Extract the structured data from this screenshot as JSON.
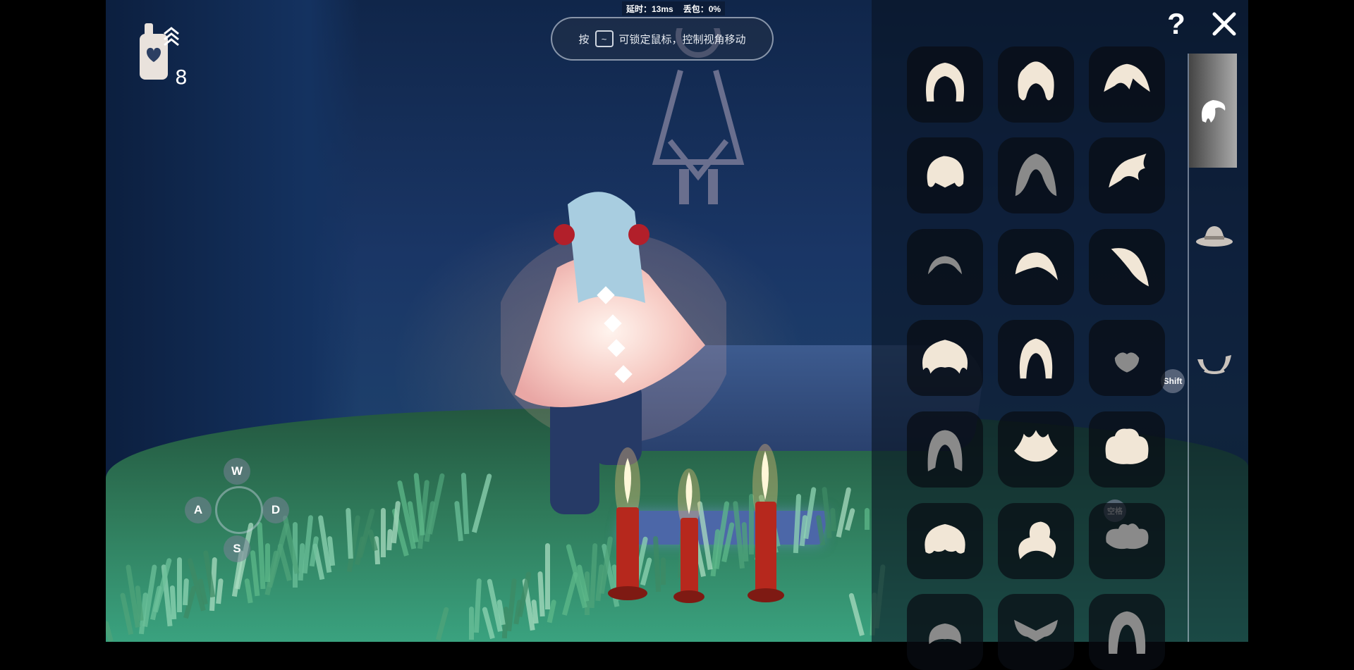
{
  "hud": {
    "latency": "延时：13ms",
    "packet_loss": "丢包：0%",
    "hint_prefix": "按",
    "hint_key": "~",
    "hint_text": "可锁定鼠标，控制视角移动",
    "candle_count": "8"
  },
  "movement_keys": {
    "up": "W",
    "left": "A",
    "down": "S",
    "right": "D"
  },
  "closet": {
    "items": [
      {
        "icon": "short-bob-hair-icon",
        "color": "#f1e6d6"
      },
      {
        "icon": "pigtails-hair-icon",
        "color": "#f1e6d6"
      },
      {
        "icon": "spiky-bang-hair-icon",
        "color": "#f1e6d6"
      },
      {
        "icon": "round-fluffy-hair-icon",
        "color": "#f1e6d6"
      },
      {
        "icon": "split-long-hair-icon",
        "color": "#8a8a8a"
      },
      {
        "icon": "swept-spike-hair-icon",
        "color": "#f1e6d6"
      },
      {
        "icon": "buzzcut-hair-icon",
        "color": "#8a8a8a"
      },
      {
        "icon": "side-swoop-hair-icon",
        "color": "#f1e6d6"
      },
      {
        "icon": "feather-tail-hair-icon",
        "color": "#f1e6d6"
      },
      {
        "icon": "curly-wide-hair-icon",
        "color": "#f1e6d6"
      },
      {
        "icon": "long-straight-hair-icon",
        "color": "#f1e6d6"
      },
      {
        "icon": "small-cap-hair-icon",
        "color": "#8a8a8a"
      },
      {
        "icon": "long-dark-hair-icon",
        "color": "#8a8a8a"
      },
      {
        "icon": "flame-top-hair-icon",
        "color": "#f1e6d6"
      },
      {
        "icon": "cloud-puff-hair-icon",
        "color": "#f1e6d6"
      },
      {
        "icon": "round-puff-hair-icon",
        "color": "#f1e6d6"
      },
      {
        "icon": "top-bun-hair-icon",
        "color": "#f1e6d6"
      },
      {
        "icon": "twin-buns-hair-icon",
        "color": "#8a8a8a"
      },
      {
        "icon": "dark-bob-hair-icon",
        "color": "#8a8a8a"
      },
      {
        "icon": "bow-hair-icon",
        "color": "#8a8a8a"
      },
      {
        "icon": "hooded-hair-icon",
        "color": "#8a8a8a"
      }
    ],
    "badges": {
      "shift": "Shift",
      "space": "空格"
    },
    "categories": [
      {
        "icon": "hair-category-icon",
        "active": true
      },
      {
        "icon": "hat-category-icon",
        "active": false
      },
      {
        "icon": "horns-category-icon",
        "active": false
      }
    ],
    "help_label": "?"
  }
}
